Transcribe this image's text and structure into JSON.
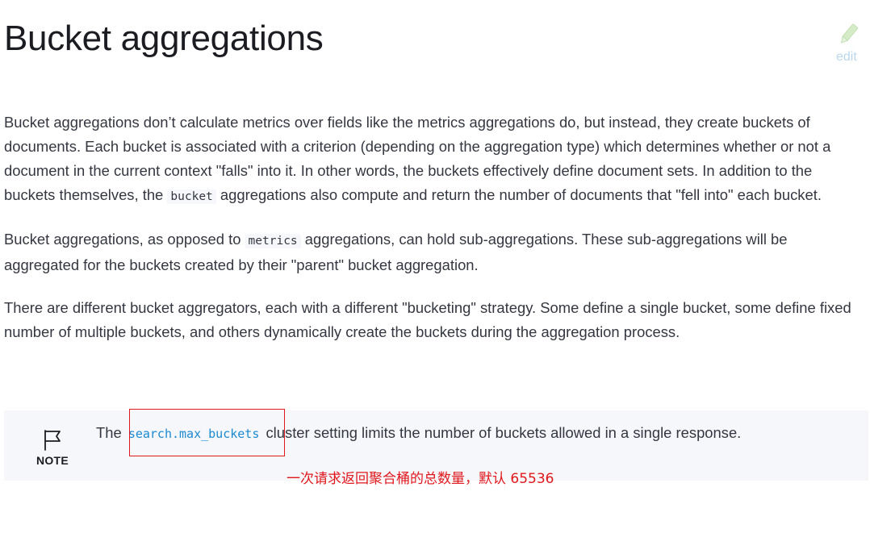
{
  "page": {
    "title": "Bucket aggregations",
    "edit_label": "edit"
  },
  "content": {
    "p1": {
      "before_code": "Bucket aggregations don’t calculate metrics over fields like the metrics aggregations do, but instead, they create buckets of documents. Each bucket is associated with a criterion (depending on the aggregation type) which determines whether or not a document in the current context \"falls\" into it. In other words, the buckets effectively define document sets. In addition to the buckets themselves, the ",
      "code": "bucket",
      "after_code": " aggregations also compute and return the number of documents that \"fell into\" each bucket."
    },
    "p2": {
      "before_code": "Bucket aggregations, as opposed to ",
      "code": "metrics",
      "after_code": " aggregations, can hold sub-aggregations. These sub-aggregations will be aggregated for the buckets created by their \"parent\" bucket aggregation."
    },
    "p3": {
      "text": "There are different bucket aggregators, each with a different \"bucketing\" strategy. Some define a single bucket, some define fixed number of multiple buckets, and others dynamically create the buckets during the aggregation process."
    }
  },
  "note": {
    "label": "NOTE",
    "icon": "flag-icon",
    "before_code": "The ",
    "code": "search.max_buckets",
    "after_code": " cluster setting limits the number of buckets allowed in a single response."
  },
  "annotation": {
    "text": "一次请求返回聚合桶的总数量，默认 65536",
    "color": "#e0181d"
  },
  "colors": {
    "link": "#1b8ad1",
    "text": "#343741",
    "note_bg": "#f5f7fa",
    "edit": "#b9d6ee",
    "pencil": "#cfe8c5"
  }
}
